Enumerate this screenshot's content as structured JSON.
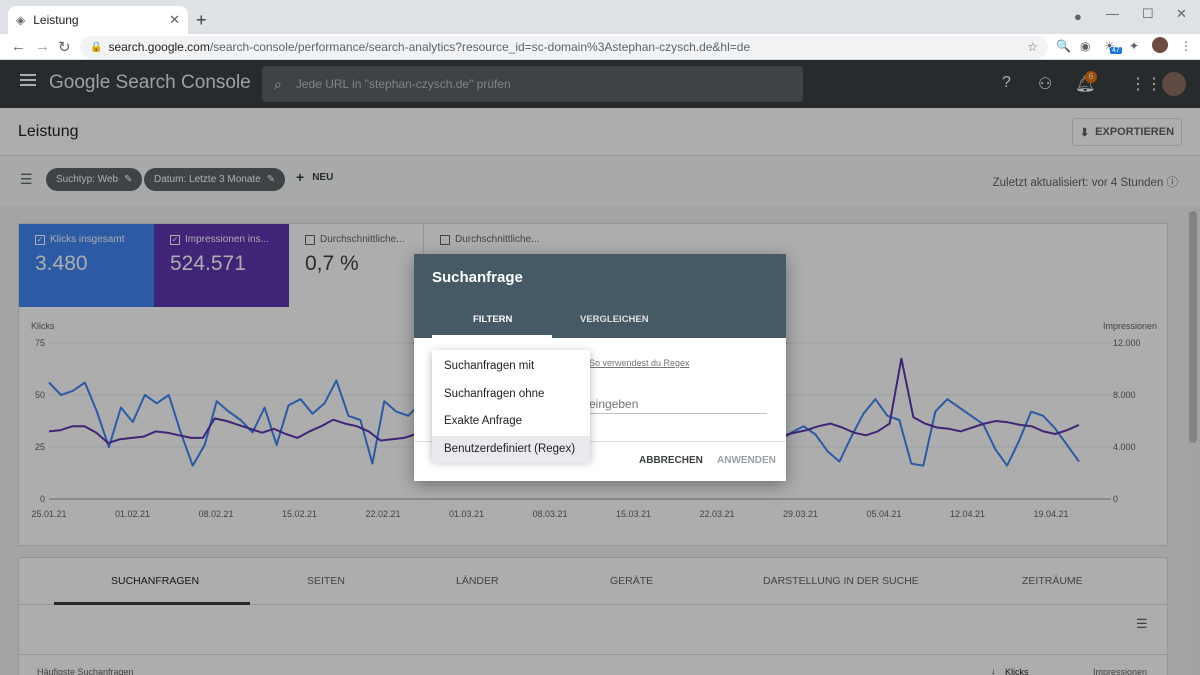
{
  "browser": {
    "tab_title": "Leistung",
    "new_tab": "+",
    "url_host": "search.google.com",
    "url_path": "/search-console/performance/search-analytics?resource_id=sc-domain%3Astephan-czysch.de&hl=de",
    "extension_badge": "47"
  },
  "app": {
    "title": "Google Search Console",
    "search_placeholder": "Jede URL in \"stephan-czysch.de\" prüfen",
    "notification_count": "6"
  },
  "page": {
    "title": "Leistung",
    "export_label": "EXPORTIEREN"
  },
  "filters": {
    "chips": [
      "Suchtyp: Web",
      "Datum: Letzte 3 Monate"
    ],
    "new_label": "NEU",
    "updated": "Zuletzt aktualisiert: vor 4 Stunden"
  },
  "metrics": [
    {
      "label": "Klicks insgesamt",
      "value": "3.480",
      "checked": true,
      "color": "#4285f4"
    },
    {
      "label": "Impressionen ins...",
      "value": "524.571",
      "checked": true,
      "color": "#5e35b1"
    },
    {
      "label": "Durchschnittliche...",
      "value": "0,7 %",
      "checked": false,
      "color": "#ffffff"
    },
    {
      "label": "Durchschnittliche...",
      "value": "",
      "checked": false,
      "color": "#ffffff"
    }
  ],
  "chart_data": {
    "type": "line",
    "ylabel": "Klicks",
    "y2label": "Impressionen",
    "yticks": [
      "75",
      "50",
      "25",
      "0"
    ],
    "y2ticks": [
      "12.000",
      "8.000",
      "4.000",
      "0"
    ],
    "ylim": [
      0,
      75
    ],
    "y2lim": [
      0,
      12000
    ],
    "xticks": [
      "25.01.21",
      "01.02.21",
      "08.02.21",
      "15.02.21",
      "22.02.21",
      "01.03.21",
      "08.03.21",
      "15.03.21",
      "22.03.21",
      "29.03.21",
      "05.04.21",
      "12.04.21",
      "19.04.21"
    ],
    "series": [
      {
        "name": "Klicks",
        "color": "#4285f4",
        "values": [
          56,
          50,
          52,
          56,
          42,
          25,
          44,
          37,
          50,
          46,
          50,
          32,
          16,
          26,
          47,
          42,
          38,
          32,
          44,
          26,
          45,
          48,
          41,
          46,
          57,
          40,
          38,
          17,
          47,
          42,
          40,
          46,
          38,
          42,
          40,
          36,
          44,
          43,
          45,
          42,
          38,
          32,
          40,
          45,
          41,
          38,
          44,
          40,
          36,
          33,
          46,
          42,
          48,
          40,
          45,
          30,
          40,
          28,
          21,
          32,
          16,
          28,
          32,
          35,
          31,
          23,
          18,
          30,
          41,
          48,
          40,
          38,
          17,
          16,
          42,
          48,
          44,
          40,
          36,
          24,
          16,
          28,
          42,
          40,
          34,
          26,
          18
        ]
      },
      {
        "name": "Impressionen",
        "color": "#5e35b1",
        "values": [
          5200,
          5300,
          5600,
          5600,
          5100,
          4300,
          4600,
          4700,
          4800,
          5200,
          5100,
          4900,
          4700,
          4700,
          6200,
          6000,
          5700,
          5400,
          5100,
          5400,
          5000,
          4700,
          5200,
          5600,
          6100,
          5800,
          5600,
          5200,
          4500,
          4600,
          4700,
          5000,
          5500,
          5800,
          6000,
          5500,
          5200,
          5000,
          4900,
          5300,
          5700,
          6200,
          6300,
          6000,
          5800,
          5500,
          5300,
          5100,
          5000,
          5300,
          5700,
          6100,
          5900,
          5500,
          5400,
          5600,
          5800,
          6000,
          5600,
          5200,
          5000,
          4800,
          4900,
          5100,
          5300,
          5600,
          5800,
          5500,
          5100,
          4900,
          5200,
          5800,
          10800,
          6300,
          5800,
          5500,
          5400,
          5200,
          5500,
          5800,
          6000,
          5900,
          5700,
          5600,
          5200,
          5000,
          5300,
          5700
        ]
      }
    ]
  },
  "dialog": {
    "title": "Suchanfrage",
    "tabs": [
      "FILTERN",
      "VERGLEICHEN"
    ],
    "regex_link": "So verwendest du Regex",
    "input_placeholder": "eingeben",
    "cancel": "ABBRECHEN",
    "apply": "ANWENDEN",
    "menu": [
      "Suchanfragen mit",
      "Suchanfragen ohne",
      "Exakte Anfrage",
      "Benutzerdefiniert (Regex)"
    ]
  },
  "table": {
    "tabs": [
      "SUCHANFRAGEN",
      "SEITEN",
      "LÄNDER",
      "GERÄTE",
      "DARSTELLUNG IN DER SUCHE",
      "ZEITRÄUME"
    ],
    "header_left": "Häufigste Suchanfragen",
    "col_clicks": "Klicks",
    "col_impressions": "Impressionen"
  }
}
